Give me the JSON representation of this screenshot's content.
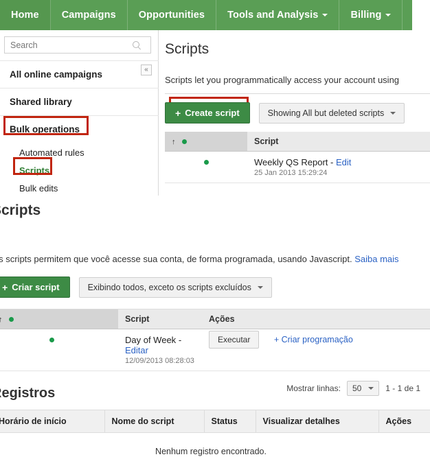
{
  "topnav": {
    "items": [
      {
        "label": "Home",
        "active": true,
        "caret": false
      },
      {
        "label": "Campaigns",
        "active": false,
        "caret": false
      },
      {
        "label": "Opportunities",
        "active": false,
        "caret": false
      },
      {
        "label": "Tools and Analysis",
        "active": false,
        "caret": true
      },
      {
        "label": "Billing",
        "active": false,
        "caret": true
      }
    ],
    "background": "#5a9e55"
  },
  "sidebar": {
    "search": {
      "placeholder": "Search",
      "value": ""
    },
    "collapse_label": "«",
    "items": [
      {
        "label": "All online campaigns"
      },
      {
        "label": "Shared library"
      },
      {
        "label": "Bulk operations"
      },
      {
        "label": "Automated rules"
      },
      {
        "label": "Scripts"
      },
      {
        "label": "Bulk edits"
      }
    ]
  },
  "annotations": {
    "color": "#c1250f"
  },
  "panel_en": {
    "title": "Scripts",
    "description": "Scripts let you programmatically access your account using",
    "create_button": "Create script",
    "plus": "+",
    "filter_dropdown": "Showing All but deleted scripts",
    "table": {
      "headers": [
        "",
        "Script"
      ],
      "rows": [
        {
          "name": "Weekly QS Report",
          "separator": "-",
          "edit": "Edit",
          "timestamp": "25 Jan 2013 15:29:24"
        }
      ]
    }
  },
  "panel_pt": {
    "title": "Scripts",
    "description": "Os scripts permitem que você acesse sua conta, de forma programada, usando Javascript.",
    "learn_more": "Saiba mais",
    "create_button": "Criar script",
    "plus": "+",
    "filter_dropdown": "Exibindo todos, exceto os scripts excluídos",
    "table": {
      "headers": [
        "",
        "Script",
        "Ações"
      ],
      "rows": [
        {
          "name": "Day of Week",
          "separator": "-",
          "edit": "Editar",
          "timestamp": "12/09/2013 08:28:03",
          "run_button": "Executar",
          "schedule_link": "+ Criar programação"
        }
      ]
    },
    "pager": {
      "rows_label": "Mostrar linhas:",
      "rows_value": "50",
      "range": "1 - 1 de 1"
    }
  },
  "panel_registros": {
    "title": "Registros",
    "headers": [
      "Horário de início",
      "Nome do script",
      "Status",
      "Visualizar detalhes",
      "Ações"
    ],
    "empty_message": "Nenhum registro encontrado."
  }
}
